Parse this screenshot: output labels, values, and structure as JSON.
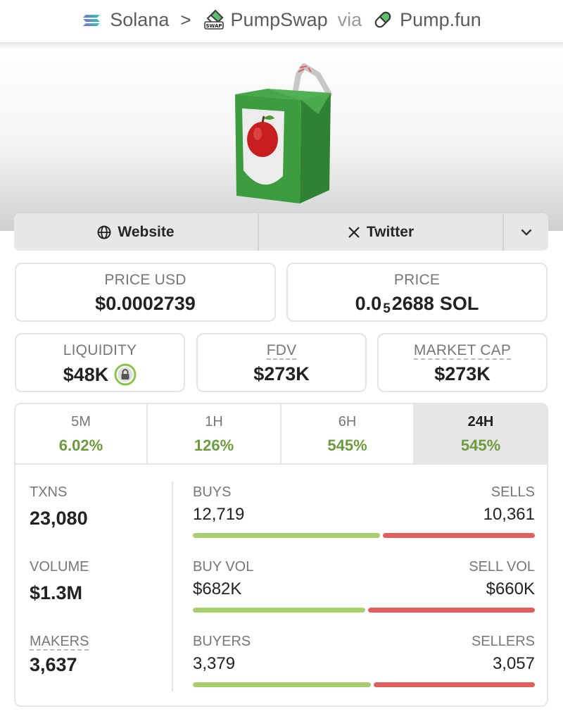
{
  "breadcrumb": {
    "chain": "Solana",
    "dex": "PumpSwap",
    "via": "via",
    "launchpad": "Pump.fun",
    "dex_icon_text": "SWAP"
  },
  "links": {
    "website": "Website",
    "twitter": "Twitter"
  },
  "price_usd": {
    "label": "PRICE USD",
    "value": "$0.0002739"
  },
  "price_native": {
    "label": "PRICE",
    "prefix": "0.0",
    "zeros": "5",
    "digits": "2688",
    "unit": "SOL"
  },
  "liquidity": {
    "label": "LIQUIDITY",
    "value": "$48K"
  },
  "fdv": {
    "label": "FDV",
    "value": "$273K"
  },
  "market_cap": {
    "label": "MARKET CAP",
    "value": "$273K"
  },
  "timeframes": [
    {
      "label": "5M",
      "change": "6.02%"
    },
    {
      "label": "1H",
      "change": "126%"
    },
    {
      "label": "6H",
      "change": "545%"
    },
    {
      "label": "24H",
      "change": "545%"
    }
  ],
  "active_timeframe": "24H",
  "txns": {
    "label": "TXNS",
    "value": "23,080",
    "buys_label": "BUYS",
    "buys": "12,719",
    "sells_label": "SELLS",
    "sells": "10,361",
    "buy_ratio": 0.551
  },
  "volume": {
    "label": "VOLUME",
    "value": "$1.3M",
    "buy_label": "BUY VOL",
    "buy": "$682K",
    "sell_label": "SELL VOL",
    "sell": "$660K",
    "buy_ratio": 0.508
  },
  "makers": {
    "label": "MAKERS",
    "value": "3,637",
    "buyers_label": "BUYERS",
    "buyers": "3,379",
    "sellers_label": "SELLERS",
    "sellers": "3,057",
    "buy_ratio": 0.525
  },
  "colors": {
    "positive": "#6d9a3e",
    "buy_bar": "#a8cf6e",
    "sell_bar": "#e2605c"
  }
}
